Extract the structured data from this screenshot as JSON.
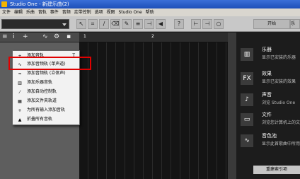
{
  "title": "Studio One - 新建乐曲(2)",
  "menubar": [
    "文件",
    "编辑",
    "乐曲",
    "音轨",
    "事件",
    "音频",
    "走带控制",
    "选项",
    "视图",
    "Studio One",
    "帮助"
  ],
  "toolbar": {
    "start_label": "开始",
    "right_label": "乐"
  },
  "track_header": {
    "add_label": "+",
    "menu_label": "≡",
    "info_label": "i"
  },
  "ruler": {
    "marker_1": "1",
    "marker_2": "2"
  },
  "context_menu": {
    "items": [
      {
        "icon": "+",
        "label": "添加音轨",
        "shortcut": "T"
      },
      {
        "icon": "∿",
        "label": "添加音频轨 (单声道)"
      },
      {
        "icon": "≈",
        "label": "添加音频轨 (立体声)"
      },
      {
        "icon": "▥",
        "label": "添加乐器音轨"
      },
      {
        "icon": "⁄",
        "label": "添加自动控制轨"
      },
      {
        "icon": "▦",
        "label": "添加文件夹轨道"
      },
      {
        "icon": "+",
        "label": "为所有输入添加音轨"
      },
      {
        "icon": "▲",
        "label": "折叠所有音轨"
      }
    ]
  },
  "browser": {
    "items": [
      {
        "icon": "▥",
        "title": "乐器",
        "desc": "显示已安装的乐器"
      },
      {
        "icon": "FX",
        "title": "效果",
        "desc": "显示已安装的效果"
      },
      {
        "icon": "♪",
        "title": "声音",
        "desc": "浏览 Studio One"
      },
      {
        "icon": "▭",
        "title": "文件",
        "desc": "浏览您计算机上的文件"
      },
      {
        "icon": "∿",
        "title": "音色池",
        "desc": "显示此首歌曲中所用"
      }
    ],
    "quick_button": "重建索引项"
  }
}
